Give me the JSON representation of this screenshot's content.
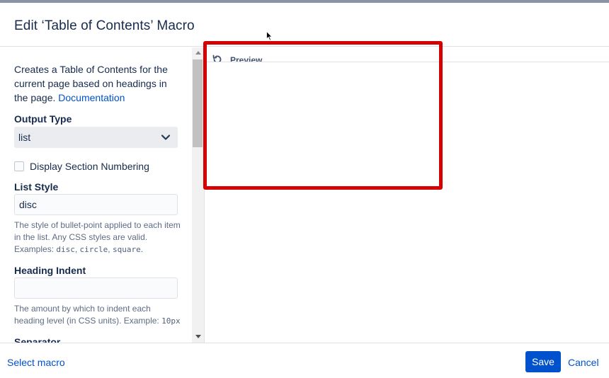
{
  "dialog": {
    "title": "Edit ‘Table of Contents’ Macro"
  },
  "form": {
    "description": "Creates a Table of Contents for the current page based on headings in the page.",
    "documentation_link": "Documentation",
    "output_type": {
      "label": "Output Type",
      "value": "list"
    },
    "section_numbering": {
      "label": "Display Section Numbering",
      "checked": false
    },
    "list_style": {
      "label": "List Style",
      "value": "disc",
      "help_text": "The style of bullet-point applied to each item in the list. Any CSS styles are valid. Examples:",
      "examples": [
        "disc",
        "circle",
        "square"
      ]
    },
    "heading_indent": {
      "label": "Heading Indent",
      "value": "",
      "help_text": "The amount by which to indent each heading level (in CSS units). Example:",
      "example": "10px"
    },
    "separator": {
      "label": "Separator"
    }
  },
  "preview": {
    "label": "Preview",
    "icon": "refresh-icon"
  },
  "footer": {
    "select_macro": "Select macro",
    "save": "Save",
    "cancel": "Cancel"
  },
  "colors": {
    "primary": "#0052cc",
    "text": "#172b4d",
    "annotation": "#d50000"
  }
}
